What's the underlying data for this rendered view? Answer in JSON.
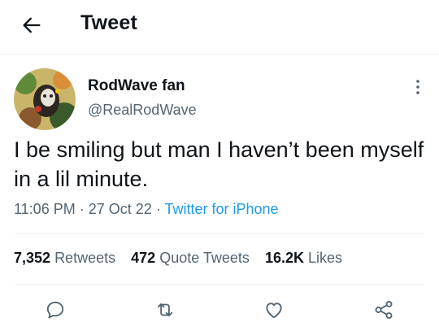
{
  "header": {
    "title": "Tweet"
  },
  "author": {
    "display_name": "RodWave fan",
    "handle": "@RealRodWave"
  },
  "tweet": {
    "text": "I be smiling but man I haven’t been myself in a lil minute.",
    "time": "11:06 PM",
    "date": "27 Oct 22",
    "separator": "·",
    "source": "Twitter for iPhone"
  },
  "stats": {
    "retweets_count": "7,352",
    "retweets_label": "Retweets",
    "quotes_count": "472",
    "quotes_label": "Quote Tweets",
    "likes_count": "16.2K",
    "likes_label": "Likes"
  },
  "icons": {
    "back": "arrow-left-icon",
    "more": "more-vertical-icon",
    "reply": "reply-icon",
    "retweet": "retweet-icon",
    "like": "heart-icon",
    "share": "share-icon"
  },
  "colors": {
    "text": "#0f1419",
    "secondary": "#536471",
    "link": "#1d9bf0"
  }
}
